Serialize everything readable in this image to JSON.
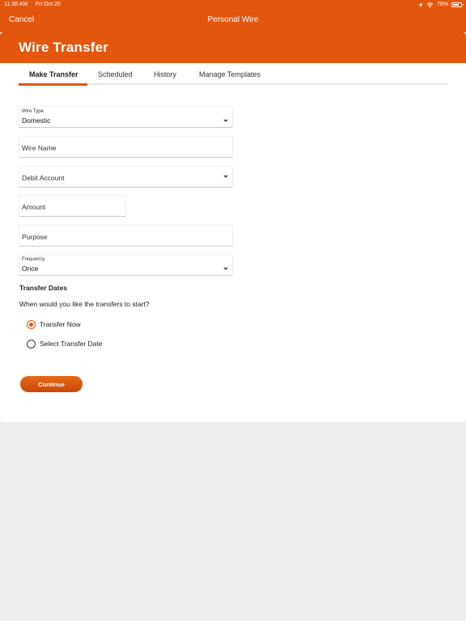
{
  "status_bar": {
    "time": "11:38 AM",
    "date": "Fri Oct 20",
    "battery": "76%"
  },
  "nav": {
    "cancel_label": "Cancel",
    "title": "Personal Wire"
  },
  "header": {
    "title": "Wire Transfer"
  },
  "tabs": [
    {
      "label": "Make Transfer",
      "active": true
    },
    {
      "label": "Scheduled",
      "active": false
    },
    {
      "label": "History",
      "active": false
    },
    {
      "label": "Manage Templates",
      "active": false
    }
  ],
  "form": {
    "wire_type": {
      "label": "Wire Type",
      "value": "Domestic"
    },
    "wire_name": {
      "placeholder": "Wire Name"
    },
    "debit_account": {
      "placeholder": "Debit Account"
    },
    "amount": {
      "placeholder": "Amount"
    },
    "purpose": {
      "placeholder": "Purpose"
    },
    "frequency": {
      "label": "Frequency",
      "value": "Once"
    }
  },
  "transfer_dates": {
    "title": "Transfer Dates",
    "question": "When would you like the transfers to start?",
    "options": [
      {
        "label": "Transfer Now",
        "selected": true
      },
      {
        "label": "Select Transfer Date",
        "selected": false
      }
    ]
  },
  "continue_label": "Continue",
  "colors": {
    "accent": "#e3560e",
    "background": "#ededed",
    "surface": "#ffffff"
  },
  "icons": [
    "location-arrow-icon",
    "wifi-icon",
    "battery-icon",
    "chevron-down-icon"
  ]
}
